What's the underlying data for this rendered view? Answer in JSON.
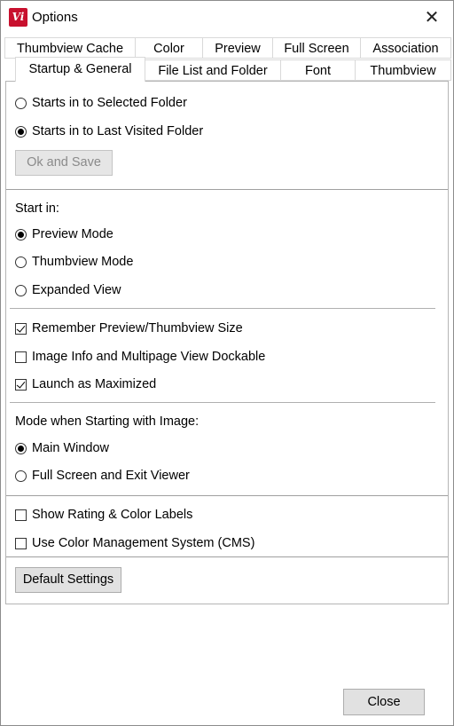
{
  "window": {
    "title": "Options",
    "app_icon": "Vi"
  },
  "tabs_row1": [
    "Thumbview Cache",
    "Color",
    "Preview",
    "Full Screen",
    "Association"
  ],
  "tabs_row2": [
    "Startup & General",
    "File List and Folder",
    "Font",
    "Thumbview"
  ],
  "startup": {
    "opt_selected_folder": "Starts in to Selected Folder",
    "opt_last_visited": "Starts in to Last Visited Folder",
    "ok_save": "Ok and Save"
  },
  "start_in": {
    "label": "Start in:",
    "preview_mode": "Preview Mode",
    "thumbview_mode": "Thumbview Mode",
    "expanded_view": "Expanded View"
  },
  "checks": {
    "remember_size": "Remember Preview/Thumbview Size",
    "image_info_dockable": "Image Info and Multipage View Dockable",
    "launch_maximized": "Launch as Maximized"
  },
  "mode_image": {
    "label": "Mode when Starting with Image:",
    "main_window": "Main Window",
    "full_screen_exit": "Full Screen and Exit Viewer"
  },
  "extras": {
    "show_rating": "Show Rating & Color Labels",
    "use_cms": "Use Color Management System (CMS)"
  },
  "buttons": {
    "default_settings": "Default Settings",
    "close": "Close"
  }
}
